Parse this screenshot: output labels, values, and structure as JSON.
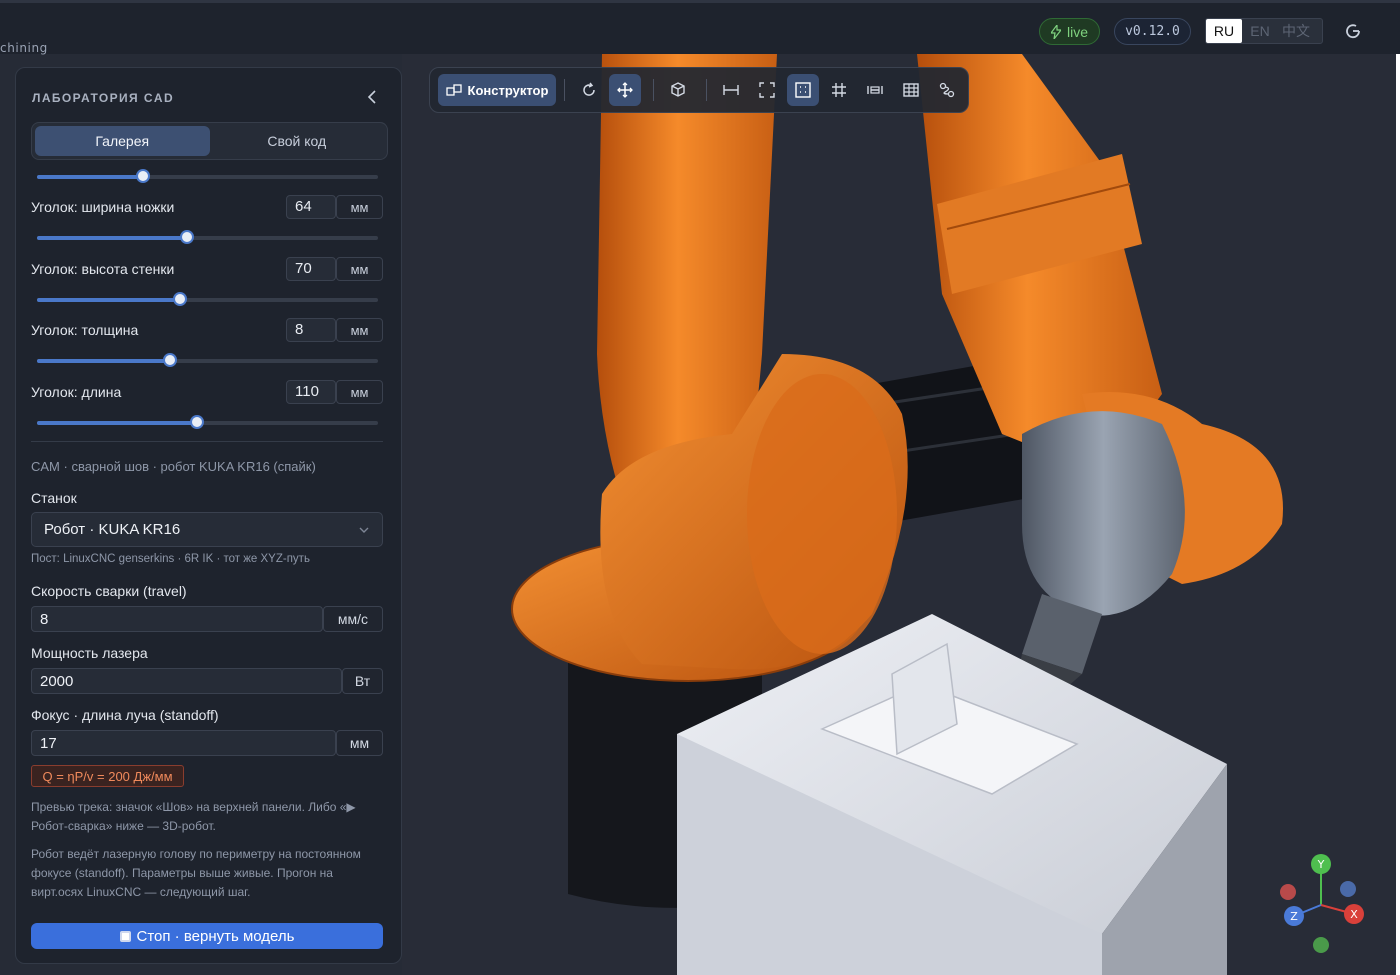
{
  "topbar": {
    "breadcrumb": "chining",
    "live_label": "live",
    "version": "v0.12.0",
    "languages": [
      "RU",
      "EN",
      "中文"
    ],
    "active_language": "RU"
  },
  "toolbar": {
    "mode_label": "Конструктор",
    "tools": [
      "rotate-icon",
      "move-icon",
      "cube-icon",
      "measure-icon",
      "fit-view-icon",
      "section-icon",
      "grid-icon",
      "dimension-icon",
      "table-icon",
      "path-icon"
    ]
  },
  "panel": {
    "title": "ЛАБОРАТОРИЯ CAD",
    "tabs": [
      "Галерея",
      "Свой код"
    ],
    "active_tab": "Галерея",
    "params": [
      {
        "label": "Уголок: ширина ножки",
        "value": "64",
        "unit": "мм",
        "fraction": 0.44
      },
      {
        "label": "Уголок: высота стенки",
        "value": "70",
        "unit": "мм",
        "fraction": 0.42
      },
      {
        "label": "Уголок: толщина",
        "value": "8",
        "unit": "мм",
        "fraction": 0.39
      },
      {
        "label": "Уголок: длина",
        "value": "110",
        "unit": "мм",
        "fraction": 0.47
      }
    ],
    "top_slider_fraction": 0.31,
    "cam_caption": "CAM · сварной шов · робот KUKA KR16 (спайк)",
    "machine_label": "Станок",
    "machine_value": "Робот · KUKA KR16",
    "post_hint": "Пост: LinuxCNC genserkins · 6R IK · тот же XYZ-путь",
    "speed_label": "Скорость сварки (travel)",
    "speed_value": "8",
    "speed_unit": "мм/с",
    "power_label": "Мощность лазера",
    "power_value": "2000",
    "power_unit": "Вт",
    "focus_label": "Фокус · длина луча (standoff)",
    "focus_value": "17",
    "focus_unit": "мм",
    "formula": "Q = ηP/v = 200 Дж/мм",
    "note1": "Превью трека: значок «Шов» на верхней панели. Либо «▶ Робот-сварка» ниже — 3D-робот.",
    "note2": "Робот ведёт лазерную голову по периметру на постоянном фокусе (standoff). Параметры выше живые. Прогон на вирт.осях LinuxCNC — следующий шаг.",
    "stop_button": "Стоп · вернуть модель"
  },
  "gizmo": {
    "y": "Y",
    "z": "Z",
    "x": "X"
  },
  "colors": {
    "robot": "#f0801f",
    "accent": "#3a6fdc",
    "panel": "#1e232d"
  }
}
